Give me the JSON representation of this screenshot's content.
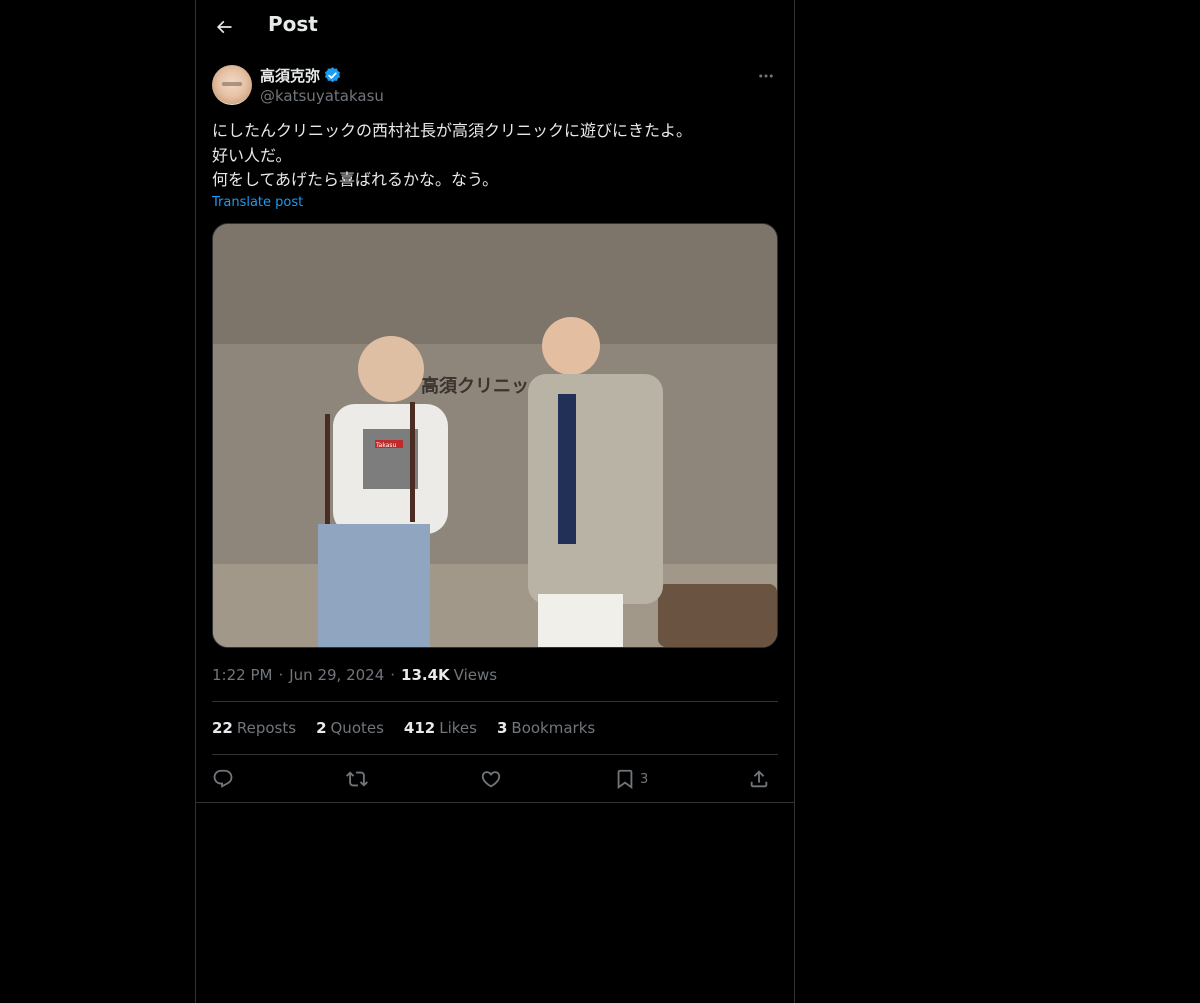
{
  "header": {
    "title": "Post"
  },
  "author": {
    "display_name": "高須克弥",
    "handle": "@katsuyatakasu",
    "verified": true
  },
  "tweet": {
    "lines": [
      "にしたんクリニックの西村社長が高須クリニックに遊びにきたよ。",
      "好い人だ。",
      "何をしてあげたら喜ばれるかな。なう。"
    ],
    "translate_label": "Translate post",
    "media": {
      "wall_sign": "高須クリニック",
      "shirt_print": "Takasu"
    }
  },
  "meta": {
    "time": "1:22 PM",
    "date": "Jun 29, 2024",
    "views_count": "13.4K",
    "views_label": "Views"
  },
  "stats": {
    "reposts": {
      "count": "22",
      "label": "Reposts"
    },
    "quotes": {
      "count": "2",
      "label": "Quotes"
    },
    "likes": {
      "count": "412",
      "label": "Likes"
    },
    "bookmarks": {
      "count": "3",
      "label": "Bookmarks"
    }
  },
  "actions": {
    "reply_icon": "reply-icon",
    "repost_icon": "repost-icon",
    "like_icon": "heart-icon",
    "bookmark_icon": "bookmark-icon",
    "bookmark_count": "3",
    "share_icon": "share-icon"
  },
  "colors": {
    "background": "#000000",
    "text": "#e7e9ea",
    "secondary": "#71767b",
    "accent": "#1d9bf0",
    "border": "#2f3336"
  }
}
